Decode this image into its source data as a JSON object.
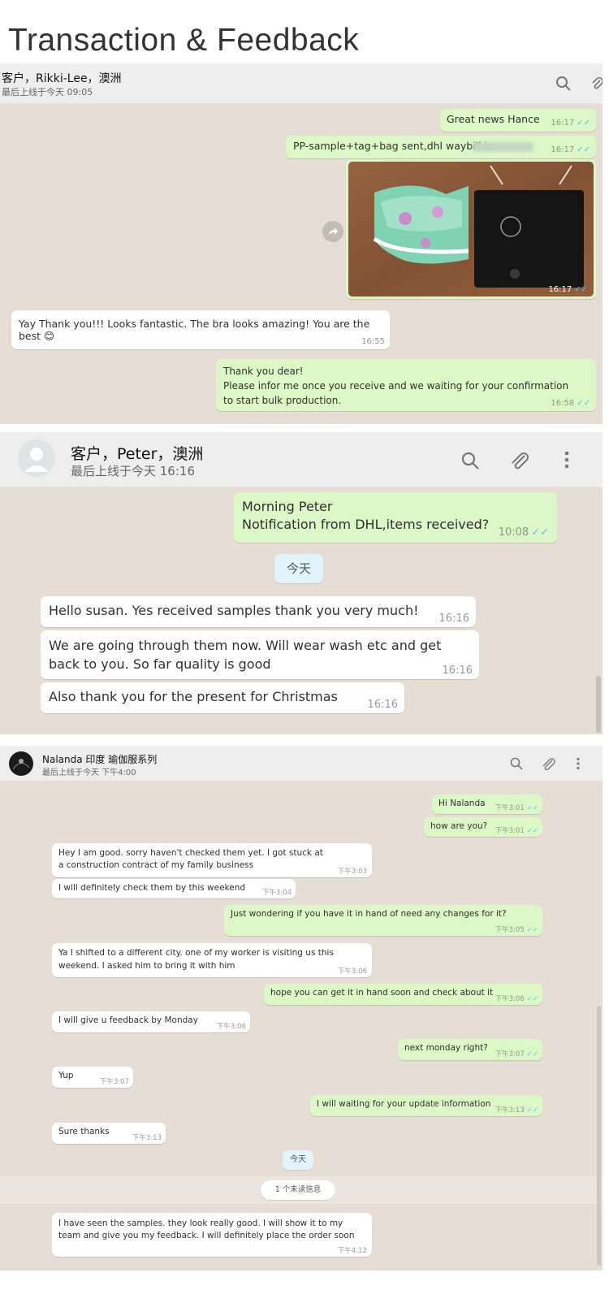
{
  "page_title": "Transaction & Feedback",
  "chat1": {
    "contact_name": "客户，Rikki-Lee，澳洲",
    "last_seen": "最后上线于今天 09:05",
    "messages": [
      {
        "dir": "out",
        "text": "Great news Hance",
        "time": "16:17"
      },
      {
        "dir": "out",
        "text": "PP-sample+tag+bag sent,dhl waybill is",
        "time": "16:17"
      },
      {
        "dir": "out",
        "type": "image",
        "time": "16:17"
      },
      {
        "dir": "in",
        "text": "Yay Thank you!!! Looks fantastic. The bra looks amazing! You are the best 😊",
        "time": "16:55"
      },
      {
        "dir": "out",
        "text": "Thank you dear!\nPlease infor me once you receive and we waiting for your confirmation to start bulk production.",
        "time": "16:58"
      }
    ]
  },
  "chat2": {
    "contact_name": "客户，Peter，澳洲",
    "last_seen": "最后上线于今天 16:16",
    "date_divider": "今天",
    "messages": [
      {
        "dir": "out",
        "text": "Morning  Peter\nNotification from DHL,items received?",
        "time": "10:08"
      },
      {
        "dir": "in",
        "text": "Hello susan. Yes received samples thank you very much!",
        "time": "16:16"
      },
      {
        "dir": "in",
        "text": "We are going through them now. Will wear wash etc and get back to you. So far quality is good",
        "time": "16:16"
      },
      {
        "dir": "in",
        "text": "Also thank you for the present for Christmas",
        "time": "16:16"
      }
    ]
  },
  "chat3": {
    "contact_name": "Nalanda 印度 瑜伽服系列",
    "last_seen": "最后上线于今天 下午4:00",
    "date_divider": "今天",
    "unread_label": "1 个未读信息",
    "messages": [
      {
        "dir": "out",
        "text": "Hi Nalanda",
        "time": "下午3:01"
      },
      {
        "dir": "out",
        "text": "how are you?",
        "time": "下午3:01"
      },
      {
        "dir": "in",
        "text": "Hey I am good. sorry haven't checked them yet. I got stuck at a construction contract of my family business",
        "time": "下午3:03"
      },
      {
        "dir": "in",
        "text": "I will definitely check them by this weekend",
        "time": "下午3:04"
      },
      {
        "dir": "out",
        "text": "Just wondering if you have it in hand of need any changes for it?",
        "time": "下午3:05"
      },
      {
        "dir": "in",
        "text": "Ya I shifted to a different city. one of my worker is visiting us this weekend. I asked him to bring it with him",
        "time": "下午3:06"
      },
      {
        "dir": "out",
        "text": "hope you can get it in hand soon and check about it",
        "time": "下午3:06"
      },
      {
        "dir": "in",
        "text": "I will give u feedback by Monday",
        "time": "下午3:06"
      },
      {
        "dir": "out",
        "text": "next monday right?",
        "time": "下午3:07"
      },
      {
        "dir": "in",
        "text": "Yup",
        "time": "下午3:07"
      },
      {
        "dir": "out",
        "text": "I will waiting for your update information",
        "time": "下午3:13"
      },
      {
        "dir": "in",
        "text": "Sure thanks",
        "time": "下午3:13"
      },
      {
        "dir": "in",
        "text": "I have seen the samples. they look really good. I will show it to my team and give you my feedback. I will definitely place the order soon",
        "time": "下午4:12"
      }
    ]
  },
  "colors": {
    "chat_bg": "#e6ddd4",
    "outgoing_bubble": "#dcf8c6",
    "incoming_bubble": "#ffffff",
    "read_ticks": "#4fc3f7",
    "header_bg": "#eeeeee"
  },
  "icons": [
    "search-icon",
    "attach-icon",
    "more-menu-icon",
    "forward-icon",
    "avatar-icon",
    "double-check-icon"
  ]
}
